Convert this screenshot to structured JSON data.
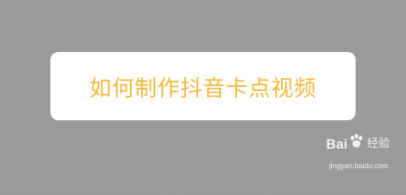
{
  "card": {
    "title": "如何制作抖音卡点视频"
  },
  "watermark": {
    "logo_text": "Baidu",
    "logo_cn": "经验",
    "url": "jingyan.baidu.com",
    "paw_icon": "baidu-paw-icon"
  },
  "colors": {
    "background": "#9a9a9a",
    "card": "#ffffff",
    "title_text": "#f2b83a",
    "watermark": "#ffffff"
  }
}
